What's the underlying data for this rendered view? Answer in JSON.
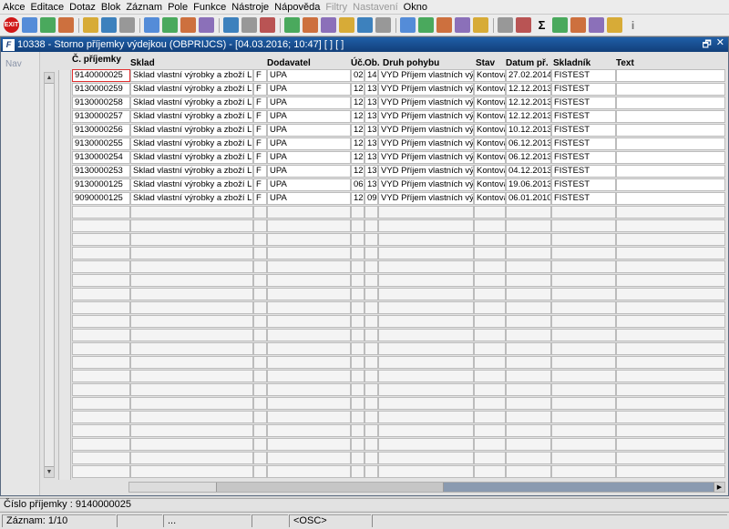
{
  "menu": [
    {
      "label": "Akce",
      "disabled": false
    },
    {
      "label": "Editace",
      "disabled": false
    },
    {
      "label": "Dotaz",
      "disabled": false
    },
    {
      "label": "Blok",
      "disabled": false
    },
    {
      "label": "Záznam",
      "disabled": false
    },
    {
      "label": "Pole",
      "disabled": false
    },
    {
      "label": "Funkce",
      "disabled": false
    },
    {
      "label": "Nástroje",
      "disabled": false
    },
    {
      "label": "Nápověda",
      "disabled": false
    },
    {
      "label": "Filtry",
      "disabled": true
    },
    {
      "label": "Nastavení",
      "disabled": true
    },
    {
      "label": "Okno",
      "disabled": false
    }
  ],
  "toolbar": {
    "exit_label": "EXIT",
    "icons": [
      "save-icon",
      "insert-icon",
      "delete-icon",
      "sep",
      "query-enter-icon",
      "query-execute-icon",
      "query-cancel-icon",
      "sep",
      "sort-asc-icon",
      "sort-desc-icon",
      "filter-icon",
      "funnel-icon",
      "sep",
      "print-icon",
      "preview-icon",
      "mail-icon",
      "sep",
      "cut-icon",
      "copy-icon",
      "paste-icon",
      "find-icon",
      "indent-icon",
      "outdent-icon",
      "sep",
      "chart-icon",
      "export-icon",
      "globe-icon",
      "star-icon",
      "warning-icon",
      "sep",
      "calendar-icon",
      "calc-icon",
      "sum-icon",
      "excel-icon",
      "word-icon",
      "help-icon",
      "help2-icon",
      "info-icon"
    ],
    "sum_glyph": "Σ",
    "info_glyph": "i"
  },
  "window": {
    "title": "10338 - Storno příjemky výdejkou (OBPRIJCS) - [04.03.2016; 10:47] [ ] [ ]",
    "icon_letter": "F",
    "restore_glyph": "🗗",
    "close_glyph": "✕",
    "nav_label": "Nav"
  },
  "table": {
    "columns": [
      "Č. příjemky",
      "Sklad",
      "",
      "Dodavatel",
      "Úč.",
      "Ob.",
      "Druh pohybu",
      "Stav",
      "Datum př.",
      "Skladník",
      "Text"
    ],
    "rows": [
      [
        "9140000025",
        "Sklad vlastní výrobky a zboží Liber",
        "F",
        "UPA",
        "02",
        "14",
        "VYD Příjem vlastních výrob",
        "Kontová",
        "27.02.2014",
        "FISTEST",
        ""
      ],
      [
        "9130000259",
        "Sklad vlastní výrobky a zboží Liber",
        "F",
        "UPA",
        "12",
        "13",
        "VYD Příjem vlastních výrob",
        "Kontová",
        "12.12.2013",
        "FISTEST",
        ""
      ],
      [
        "9130000258",
        "Sklad vlastní výrobky a zboží Liber",
        "F",
        "UPA",
        "12",
        "13",
        "VYD Příjem vlastních výrob",
        "Kontová",
        "12.12.2013",
        "FISTEST",
        ""
      ],
      [
        "9130000257",
        "Sklad vlastní výrobky a zboží Liber",
        "F",
        "UPA",
        "12",
        "13",
        "VYD Příjem vlastních výrob",
        "Kontová",
        "12.12.2013",
        "FISTEST",
        ""
      ],
      [
        "9130000256",
        "Sklad vlastní výrobky a zboží Liber",
        "F",
        "UPA",
        "12",
        "13",
        "VYD Příjem vlastních výrob",
        "Kontová",
        "10.12.2013",
        "FISTEST",
        ""
      ],
      [
        "9130000255",
        "Sklad vlastní výrobky a zboží Liber",
        "F",
        "UPA",
        "12",
        "13",
        "VYD Příjem vlastních výrob",
        "Kontová",
        "06.12.2013",
        "FISTEST",
        ""
      ],
      [
        "9130000254",
        "Sklad vlastní výrobky a zboží Liber",
        "F",
        "UPA",
        "12",
        "13",
        "VYD Příjem vlastních výrob",
        "Kontová",
        "06.12.2013",
        "FISTEST",
        ""
      ],
      [
        "9130000253",
        "Sklad vlastní výrobky a zboží Liber",
        "F",
        "UPA",
        "12",
        "13",
        "VYD Příjem vlastních výrob",
        "Kontová",
        "04.12.2013",
        "FISTEST",
        ""
      ],
      [
        "9130000125",
        "Sklad vlastní výrobky a zboží Liber",
        "F",
        "UPA",
        "06",
        "13",
        "VYD Příjem vlastních výrob",
        "Kontová",
        "19.06.2013",
        "FISTEST",
        ""
      ],
      [
        "9090000125",
        "Sklad vlastní výrobky a zboží Liber",
        "F",
        "UPA",
        "12",
        "09",
        "VYD Příjem vlastních výrob",
        "Kontová",
        "06.01.2010",
        "FISTEST",
        ""
      ]
    ]
  },
  "status": {
    "field_info": "Číslo příjemky : 9140000025",
    "record": "Záznam: 1/10",
    "seg3": "...",
    "osc": "<OSC>"
  }
}
